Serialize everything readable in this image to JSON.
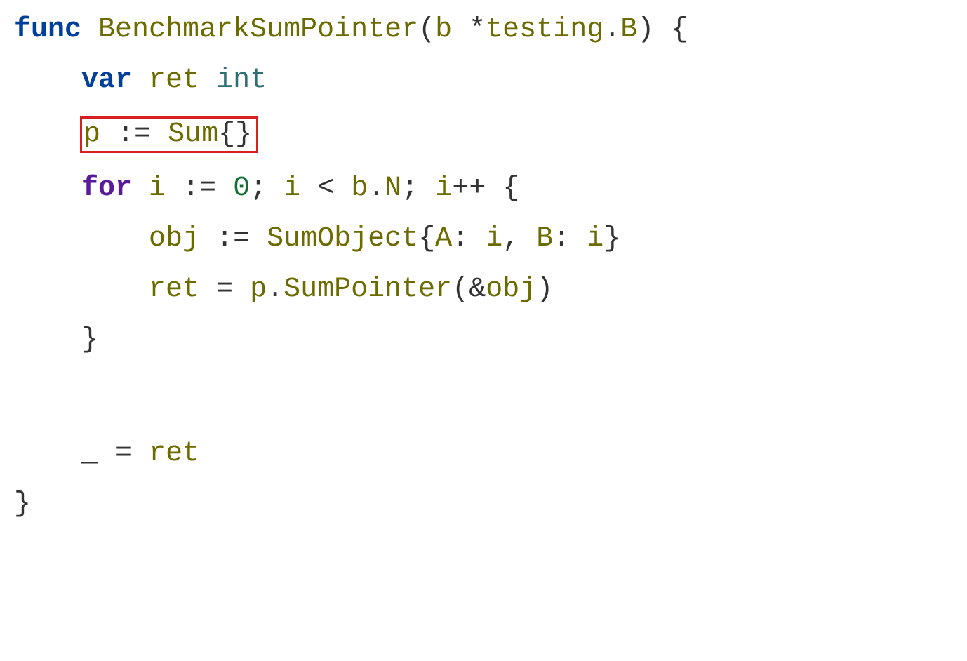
{
  "code": {
    "line1": {
      "kw_func": "func",
      "space1": " ",
      "fn_name": "BenchmarkSumPointer",
      "paren_open": "(",
      "param_b": "b",
      "space2": " ",
      "star": "*",
      "pkg": "testing",
      "dot": ".",
      "type_b": "B",
      "paren_close": ")",
      "space3": " ",
      "brace_open": "{"
    },
    "line2": {
      "indent": "    ",
      "kw_var": "var",
      "space1": " ",
      "id_ret": "ret",
      "space2": " ",
      "type_int": "int"
    },
    "line3": {
      "indent": "    ",
      "id_p": "p",
      "space1": " ",
      "op_decl": ":=",
      "space2": " ",
      "type_sum": "Sum",
      "braces": "{}"
    },
    "line4": {
      "indent": "    ",
      "kw_for": "for",
      "space1": " ",
      "id_i1": "i",
      "space2": " ",
      "op_decl": ":=",
      "space3": " ",
      "zero": "0",
      "semi1": ";",
      "space4": " ",
      "id_i2": "i",
      "space5": " ",
      "lt": "<",
      "space6": " ",
      "id_b": "b",
      "dot": ".",
      "id_N": "N",
      "semi2": ";",
      "space7": " ",
      "id_i3": "i",
      "inc": "++",
      "space8": " ",
      "brace_open": "{"
    },
    "line5": {
      "indent": "        ",
      "id_obj": "obj",
      "space1": " ",
      "op_decl": ":=",
      "space2": " ",
      "type_sumobj": "SumObject",
      "brace_open": "{",
      "id_A": "A",
      "colon1": ":",
      "space3": " ",
      "id_i1": "i",
      "comma": ",",
      "space4": " ",
      "id_B": "B",
      "colon2": ":",
      "space5": " ",
      "id_i2": "i",
      "brace_close": "}"
    },
    "line6": {
      "indent": "        ",
      "id_ret": "ret",
      "space1": " ",
      "eq": "=",
      "space2": " ",
      "id_p": "p",
      "dot": ".",
      "method": "SumPointer",
      "paren_open": "(",
      "amp": "&",
      "id_obj": "obj",
      "paren_close": ")"
    },
    "line7": {
      "indent": "    ",
      "brace_close": "}"
    },
    "line8": {
      "indent": "    ",
      "underscore": "_",
      "space1": " ",
      "eq": "=",
      "space2": " ",
      "id_ret": "ret"
    },
    "line9": {
      "brace_close": "}"
    }
  },
  "highlight": {
    "line_index": 3,
    "description": "p := Sum{} highlighted with red box"
  }
}
